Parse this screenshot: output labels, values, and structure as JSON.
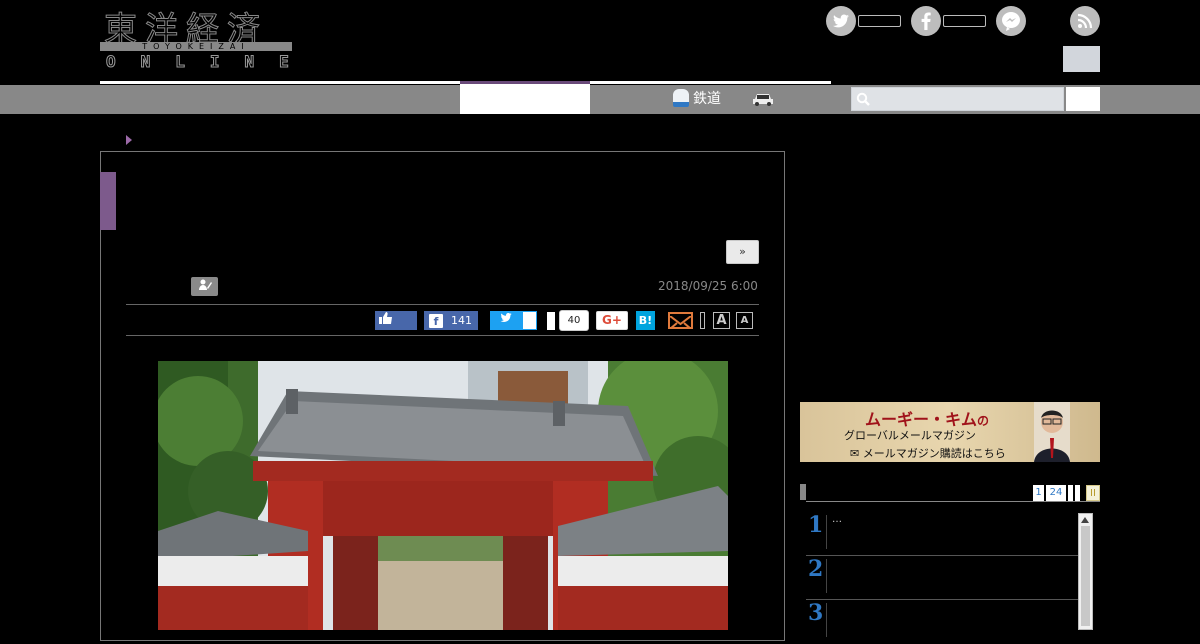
{
  "header": {
    "logo_jp": "東洋経済",
    "logo_romaji": "TOYOKEIZAI",
    "logo_online": "ONLINE"
  },
  "social": {
    "twitter_icon": "twitter-icon",
    "facebook_icon": "facebook-icon",
    "messenger_icon": "messenger-icon",
    "rss_icon": "rss-icon"
  },
  "nav": {
    "rail_label": "鉄道",
    "search_placeholder": ""
  },
  "article": {
    "more_label": "»",
    "date": "2018/09/25 6:00",
    "share": {
      "fb_count": "141",
      "pocket_count": "40",
      "gplus_label": "G+",
      "hatena_label": "B!",
      "font_large": "A",
      "font_small": "A"
    }
  },
  "sidebar": {
    "banner": {
      "title_name": "ムーギー・キム",
      "title_no": "の",
      "subtitle": "グローバルメールマガジン",
      "cta": "✉ メールマガジン購読はこちら"
    },
    "ranking": {
      "tabs": [
        "1",
        "24",
        "",
        "",
        "II"
      ],
      "rows": [
        {
          "rank": "1",
          "text": "…"
        },
        {
          "rank": "2",
          "text": ""
        },
        {
          "rank": "3",
          "text": ""
        }
      ]
    }
  },
  "colors": {
    "accent_purple": "#7d5a8c",
    "facebook": "#4867aa",
    "twitter": "#1da1f2",
    "hatena": "#00a4de",
    "rank_blue": "#2f78c4"
  }
}
